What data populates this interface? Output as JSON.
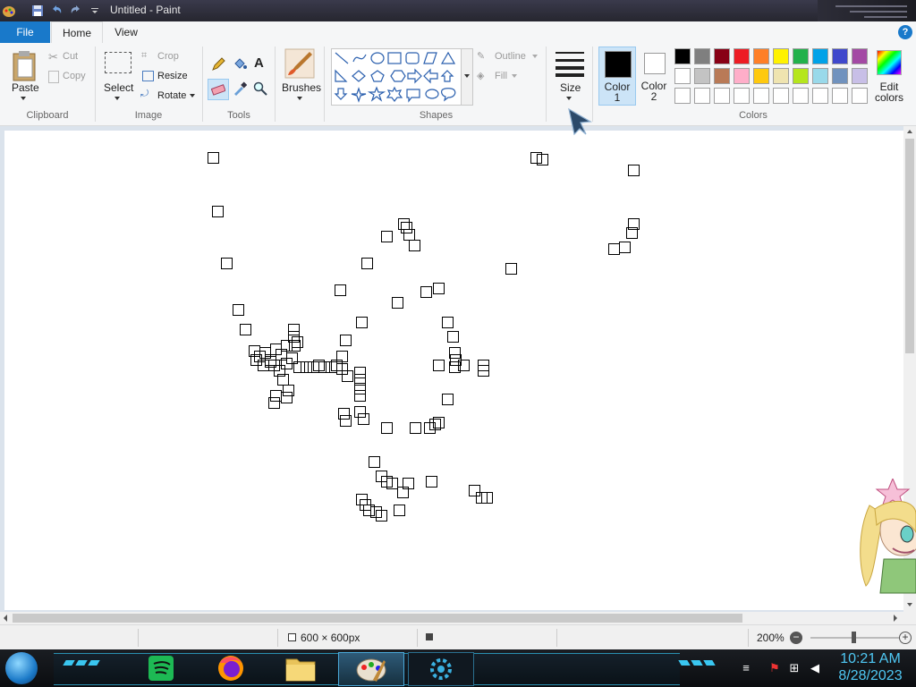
{
  "window": {
    "title": "Untitled - Paint"
  },
  "tabs": {
    "file": "File",
    "home": "Home",
    "view": "View",
    "help": "?"
  },
  "ribbon": {
    "clipboard": {
      "paste": "Paste",
      "cut": "Cut",
      "copy": "Copy",
      "group": "Clipboard"
    },
    "image": {
      "select": "Select",
      "crop": "Crop",
      "resize": "Resize",
      "rotate": "Rotate",
      "group": "Image"
    },
    "tools": {
      "group": "Tools"
    },
    "brushes": {
      "label": "Brushes"
    },
    "shapes": {
      "outline": "Outline",
      "fill": "Fill",
      "group": "Shapes"
    },
    "size": {
      "label": "Size"
    },
    "colors": {
      "color1": "Color 1",
      "color2": "Color 2",
      "edit": "Edit colors",
      "group": "Colors",
      "color1_value": "#000000",
      "color2_value": "#ffffff",
      "palette_row1": [
        "#000000",
        "#7f7f7f",
        "#880015",
        "#ed1c24",
        "#ff7f27",
        "#fff200",
        "#22b14c",
        "#00a2e8",
        "#3f48cc",
        "#a349a4"
      ],
      "palette_row2": [
        "#ffffff",
        "#c3c3c3",
        "#b97a57",
        "#ffaec9",
        "#ffc90e",
        "#efe4b0",
        "#b5e61d",
        "#99d9ea",
        "#7092be",
        "#c8bfe7"
      ],
      "palette_row3": [
        "#ffffff",
        "#ffffff",
        "#ffffff",
        "#ffffff",
        "#ffffff",
        "#ffffff",
        "#ffffff",
        "#ffffff",
        "#ffffff",
        "#ffffff"
      ]
    }
  },
  "status": {
    "canvas_size": "600 × 600px",
    "zoom": "200%"
  },
  "taskbar": {
    "apps": [
      "start-orb",
      "spotify",
      "firefox",
      "file-explorer",
      "paint",
      "app-settings"
    ],
    "time": "10:21 AM",
    "date": "8/28/2023"
  }
}
